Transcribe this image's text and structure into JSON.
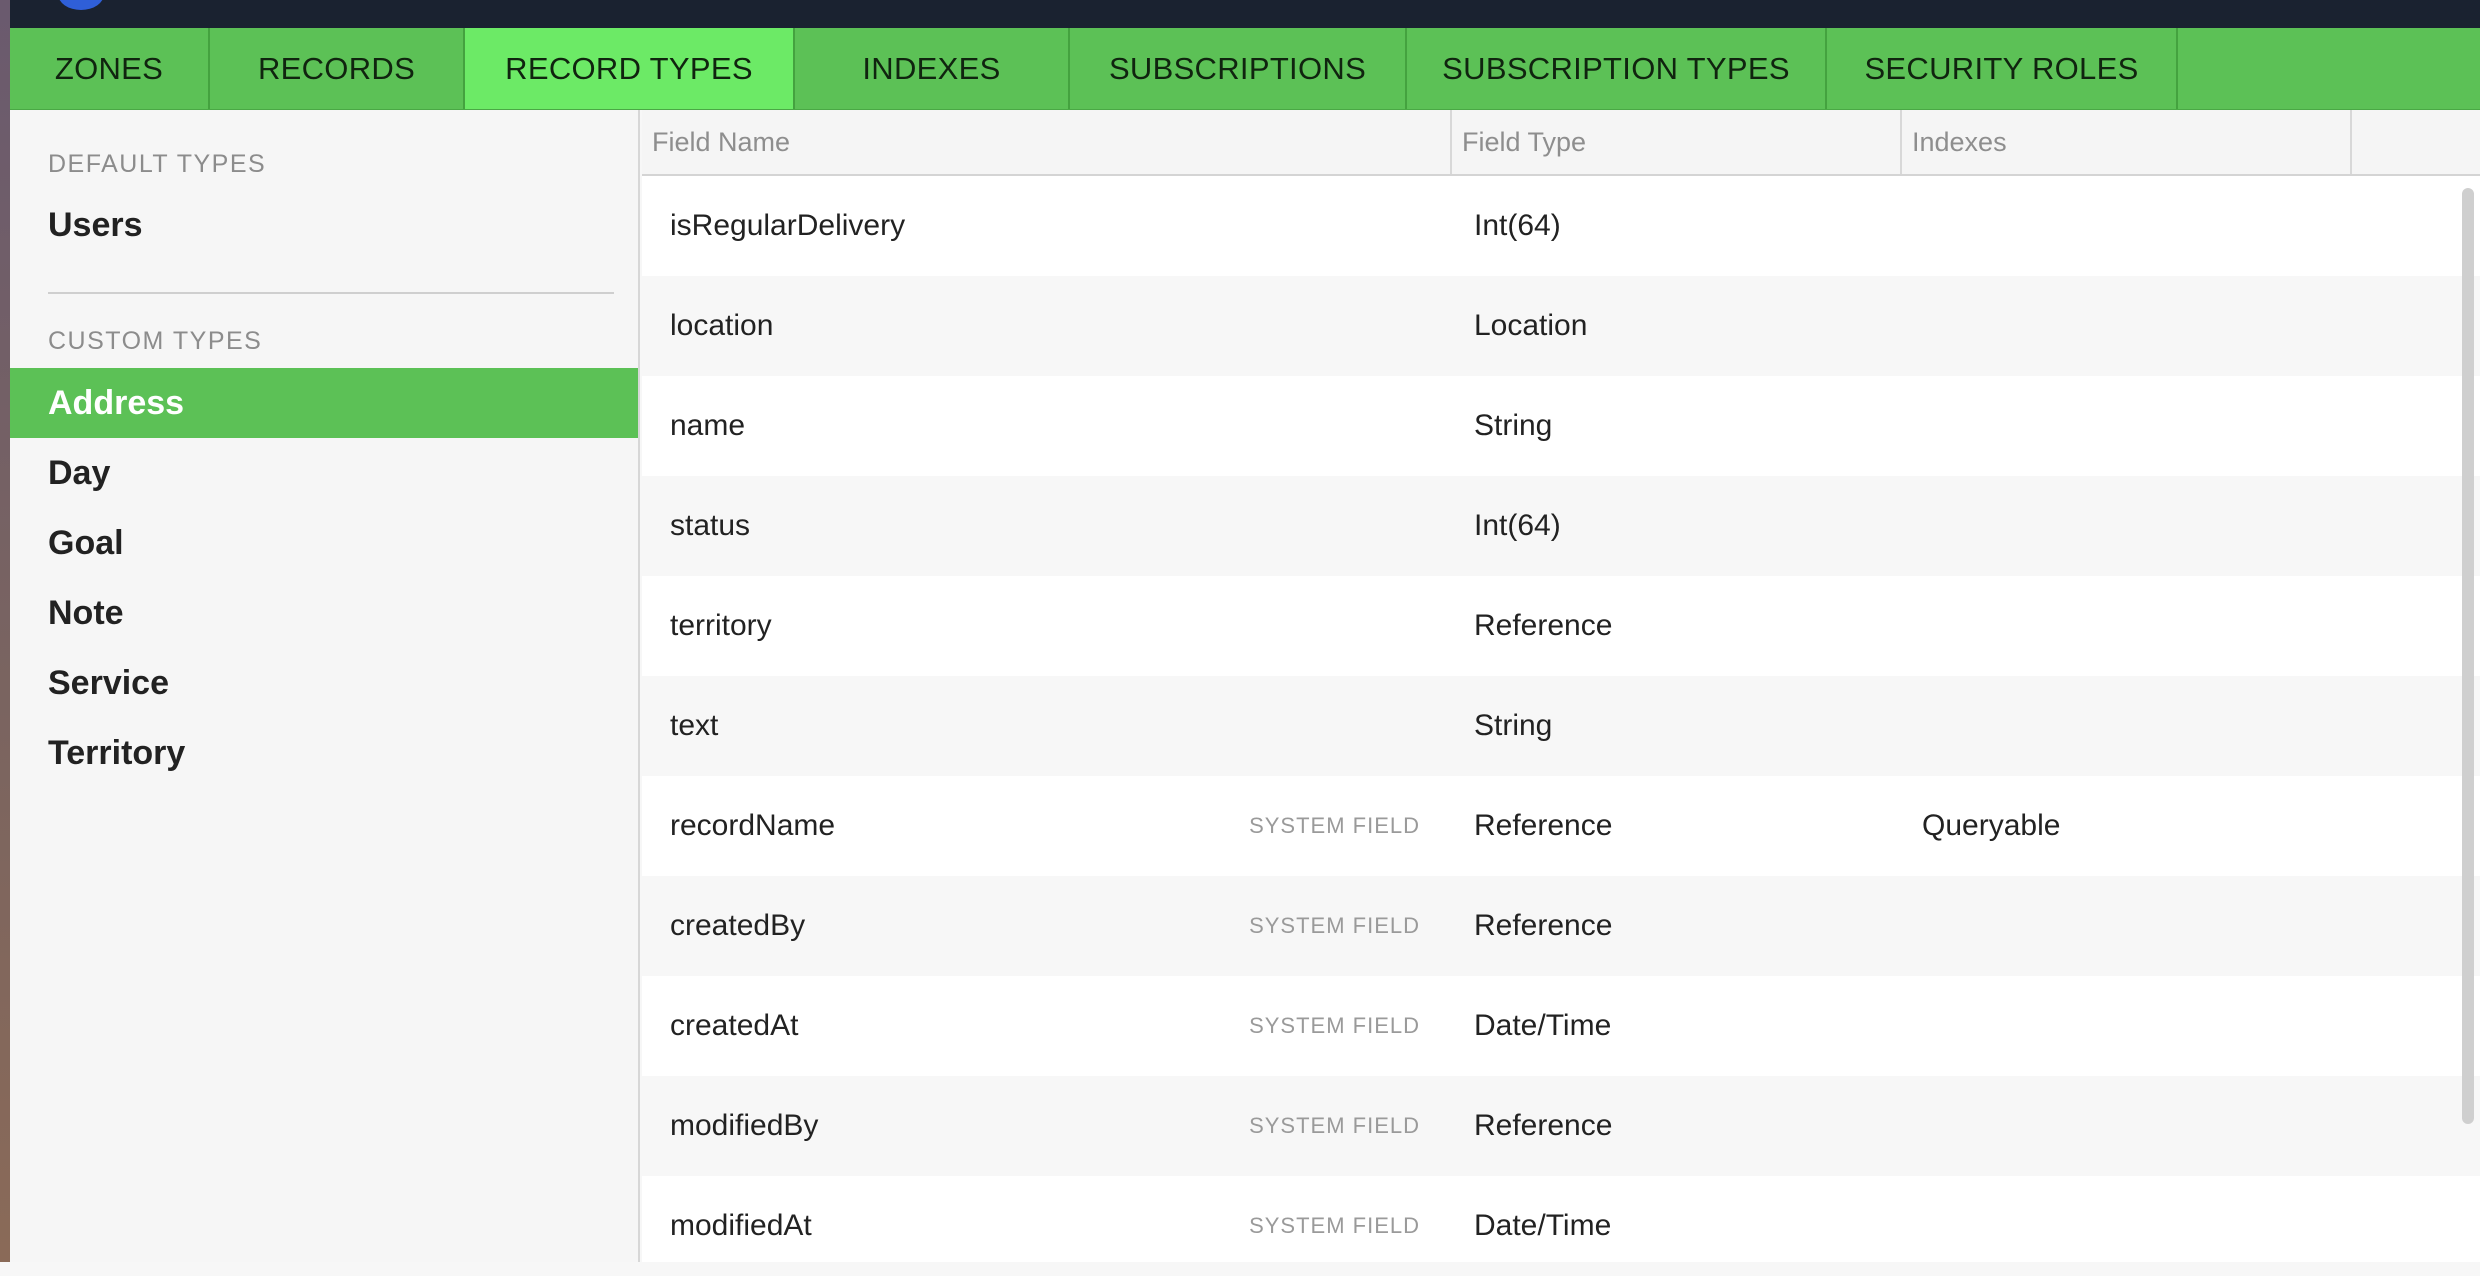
{
  "colors": {
    "tab_bar": "#5cc156",
    "tab_active": "#6cea66",
    "sidebar_active": "#5cc156",
    "topbar": "#1a2230"
  },
  "tabs": [
    {
      "label": "ZONES",
      "active": false
    },
    {
      "label": "RECORDS",
      "active": false
    },
    {
      "label": "RECORD TYPES",
      "active": true
    },
    {
      "label": "INDEXES",
      "active": false
    },
    {
      "label": "SUBSCRIPTIONS",
      "active": false
    },
    {
      "label": "SUBSCRIPTION TYPES",
      "active": false
    },
    {
      "label": "SECURITY ROLES",
      "active": false
    }
  ],
  "sidebar": {
    "default_heading": "DEFAULT TYPES",
    "default_items": [
      {
        "label": "Users",
        "active": false
      }
    ],
    "custom_heading": "CUSTOM TYPES",
    "custom_items": [
      {
        "label": "Address",
        "active": true
      },
      {
        "label": "Day",
        "active": false
      },
      {
        "label": "Goal",
        "active": false
      },
      {
        "label": "Note",
        "active": false
      },
      {
        "label": "Service",
        "active": false
      },
      {
        "label": "Territory",
        "active": false
      }
    ]
  },
  "table": {
    "columns": [
      "Field Name",
      "Field Type",
      "Indexes"
    ],
    "rows": [
      {
        "name": "isRegularDelivery",
        "system": "",
        "type": "Int(64)",
        "indexes": ""
      },
      {
        "name": "location",
        "system": "",
        "type": "Location",
        "indexes": ""
      },
      {
        "name": "name",
        "system": "",
        "type": "String",
        "indexes": ""
      },
      {
        "name": "status",
        "system": "",
        "type": "Int(64)",
        "indexes": ""
      },
      {
        "name": "territory",
        "system": "",
        "type": "Reference",
        "indexes": ""
      },
      {
        "name": "text",
        "system": "",
        "type": "String",
        "indexes": ""
      },
      {
        "name": "recordName",
        "system": "SYSTEM FIELD",
        "type": "Reference",
        "indexes": "Queryable"
      },
      {
        "name": "createdBy",
        "system": "SYSTEM FIELD",
        "type": "Reference",
        "indexes": ""
      },
      {
        "name": "createdAt",
        "system": "SYSTEM FIELD",
        "type": "Date/Time",
        "indexes": ""
      },
      {
        "name": "modifiedBy",
        "system": "SYSTEM FIELD",
        "type": "Reference",
        "indexes": ""
      },
      {
        "name": "modifiedAt",
        "system": "SYSTEM FIELD",
        "type": "Date/Time",
        "indexes": ""
      }
    ]
  }
}
